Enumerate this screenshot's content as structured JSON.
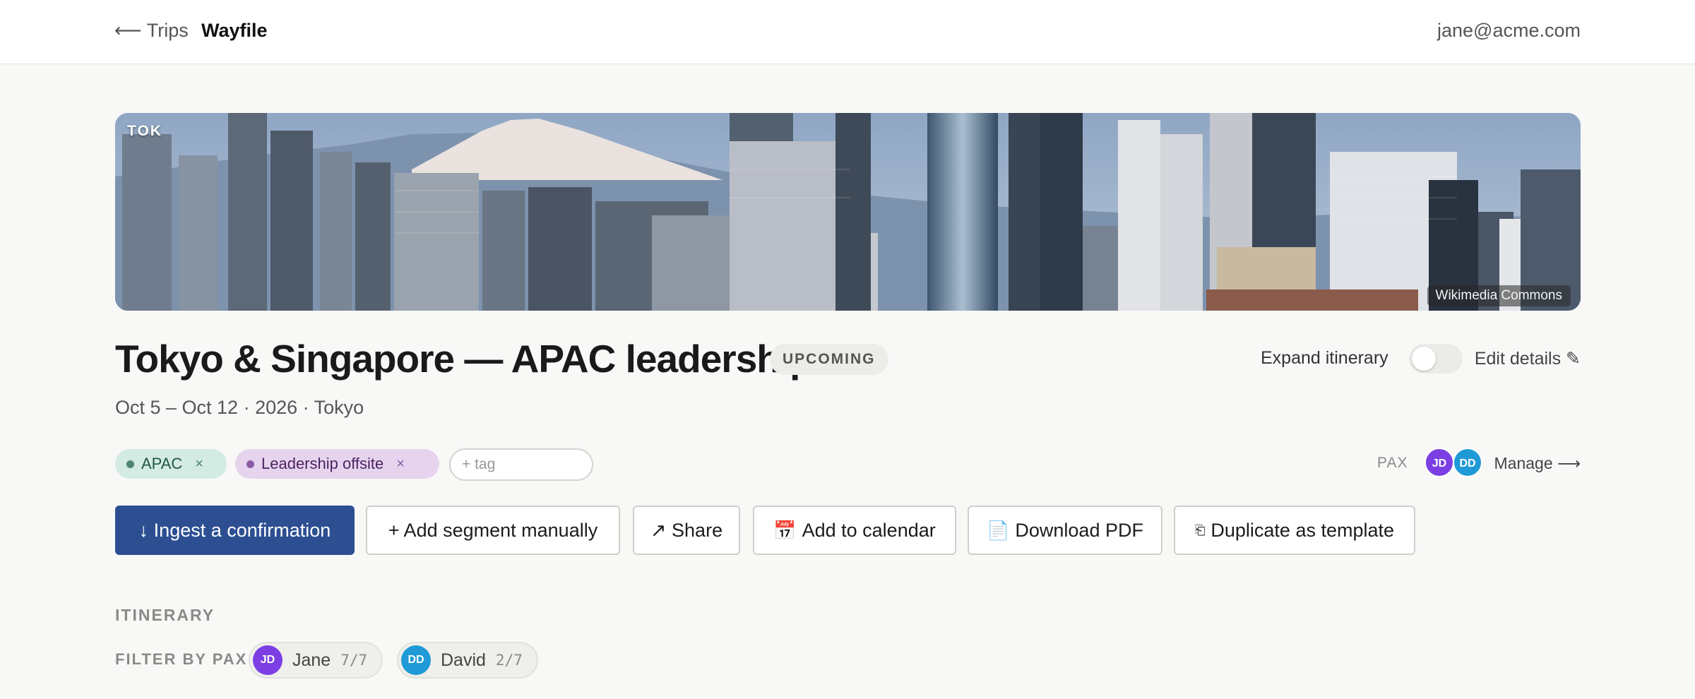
{
  "topbar": {
    "back_label": "⟵ Trips",
    "brand": "Wayfile",
    "user_email": "jane@acme.com"
  },
  "hero": {
    "code": "TOK",
    "credit": "Wikimedia Commons"
  },
  "trip": {
    "title": "Tokyo & Singapore — APAC leadership",
    "status": "UPCOMING",
    "subtitle": "Oct 5 – Oct 12 · 2026 · Tokyo",
    "expand_label": "Expand itinerary",
    "expand_on": false,
    "edit_label": "Edit details ✎"
  },
  "tags": [
    {
      "label": "APAC",
      "remove": "×",
      "color": "#d3ebe3"
    },
    {
      "label": "Leadership offsite",
      "remove": "×",
      "color": "#e6d4ee"
    }
  ],
  "tag_input": {
    "placeholder": "+ tag"
  },
  "pax": {
    "label": "PAX",
    "avatars": [
      "JD",
      "DD"
    ],
    "manage_label": "Manage ⟶"
  },
  "actions": {
    "ingest": "↓ Ingest a confirmation",
    "add_segment": "+ Add segment manually",
    "share": "↗ Share",
    "calendar_icon": "📅",
    "calendar": "Add to calendar",
    "pdf_icon": "📄",
    "pdf": "Download PDF",
    "duplicate_icon": "⎗",
    "duplicate": "Duplicate as template"
  },
  "itinerary": {
    "section_label": "ITINERARY",
    "filter_label": "FILTER BY PAX",
    "people": [
      {
        "initials": "JD",
        "name": "Jane",
        "count": "7/7",
        "color": "#7b3fe4"
      },
      {
        "initials": "DD",
        "name": "David",
        "count": "2/7",
        "color": "#1f9ad6"
      }
    ]
  },
  "colors": {
    "primary": "#2d4f92",
    "page_bg": "#f8f8f7"
  }
}
